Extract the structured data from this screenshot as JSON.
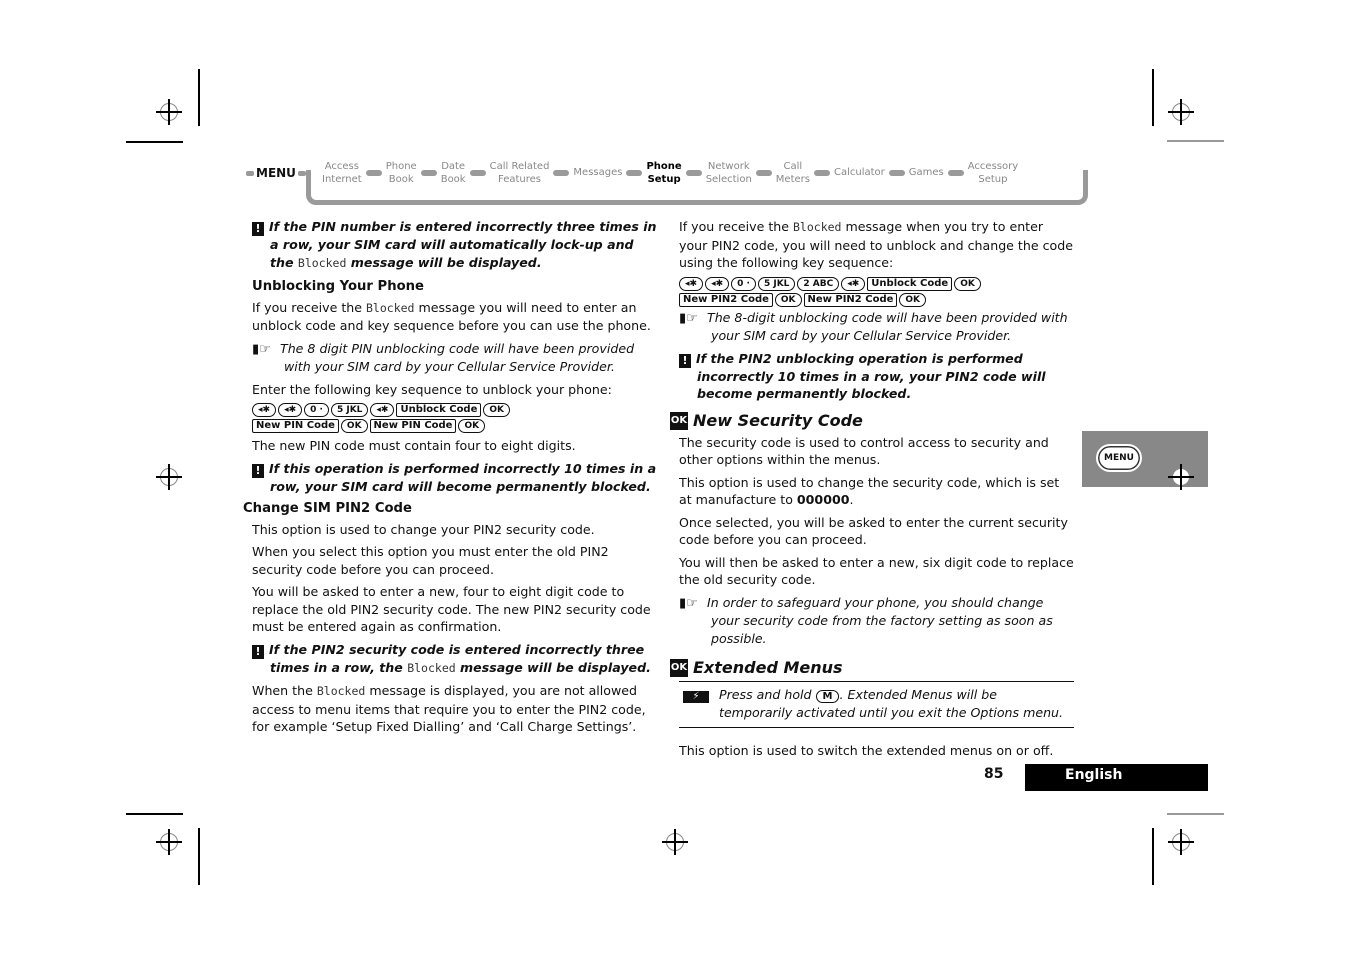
{
  "nav": {
    "menu_label": "MENU",
    "items": [
      {
        "line1": "Access",
        "line2": "Internet",
        "active": false
      },
      {
        "line1": "Phone",
        "line2": "Book",
        "active": false
      },
      {
        "line1": "Date",
        "line2": "Book",
        "active": false
      },
      {
        "line1": "Call Related",
        "line2": "Features",
        "active": false
      },
      {
        "line1": "Messages",
        "line2": "",
        "active": false
      },
      {
        "line1": "Phone",
        "line2": "Setup",
        "active": true
      },
      {
        "line1": "Network",
        "line2": "Selection",
        "active": false
      },
      {
        "line1": "Call",
        "line2": "Meters",
        "active": false
      },
      {
        "line1": "Calculator",
        "line2": "",
        "active": false
      },
      {
        "line1": "Games",
        "line2": "",
        "active": false
      },
      {
        "line1": "Accessory",
        "line2": "Setup",
        "active": false
      }
    ]
  },
  "left": {
    "warning1": {
      "pre": "If the PIN number is entered incorrectly three times in a row, your SIM card will automatically lock-up and the ",
      "lcd": "Blocked",
      "post": " message will be displayed."
    },
    "unblock_heading": "Unblocking Your Phone",
    "unblock_p1": {
      "pre": "If you receive the ",
      "lcd": "Blocked",
      "post": " message you will need to enter an unblock code and key sequence before you can use the phone."
    },
    "unblock_note": "The 8 digit PIN unblocking code will have been provided with your SIM card by your Cellular Service Provider.",
    "unblock_p2": "Enter the following key sequence to unblock your phone:",
    "keys_row1": [
      "◂✱",
      "◂✱",
      "0 ·",
      "5 JKL",
      "◂✱"
    ],
    "soft1": "Unblock Code",
    "ok": "OK",
    "soft2": "New PIN Code",
    "soft3": "New PIN Code",
    "pin_digits": "The new PIN code must contain four to eight digits.",
    "warning2": "If this operation is performed incorrectly 10 times in a row, your SIM card will become permanently blocked.",
    "pin2_heading": "Change SIM PIN2 Code",
    "pin2_p1": "This option is used to change your PIN2 security code.",
    "pin2_p2": "When you select this option you must enter the old PIN2 security code before you can proceed.",
    "pin2_p3": "You will be asked to enter a new, four to eight digit code to replace the old PIN2 security code. The new PIN2 security code must be entered again as confirmation.",
    "warning3": {
      "pre": "If the PIN2 security code is entered incorrectly three times in a row, the ",
      "lcd": "Blocked",
      "post": " message will be displayed."
    },
    "pin2_p4": {
      "pre": "When the ",
      "lcd": "Blocked",
      "post": " message is displayed, you are not allowed access to menu items that require you to enter the PIN2 code, for example ‘Setup Fixed Dialling’ and ‘Call Charge Settings’."
    }
  },
  "right": {
    "p1": {
      "pre": "If you receive the ",
      "lcd": "Blocked",
      "post": " message when you try to enter your PIN2 code, you will need to unblock and change the code using the following key sequence:"
    },
    "keys_row1": [
      "◂✱",
      "◂✱",
      "0 ·",
      "5 JKL",
      "2 ABC",
      "◂✱"
    ],
    "soft1": "Unblock Code",
    "ok": "OK",
    "soft2": "New PIN2 Code",
    "soft3": "New PIN2 Code",
    "note1": "The 8-digit unblocking code will have been provided with your SIM card by your Cellular Service Provider.",
    "warning1": "If the PIN2 unblocking operation is performed incorrectly 10 times in a row, your PIN2 code will become permanently blocked.",
    "security_heading": "New Security Code",
    "ok_icon": "OK",
    "sec_p1": "The security code is used to control access to security and other options within the menus.",
    "sec_p2_pre": "This option is used to change the security code, which is set at manufacture to ",
    "sec_p2_code": "000000",
    "sec_p2_post": ".",
    "sec_p3": "Once selected, you will be asked to enter the current security code before you can proceed.",
    "sec_p4": "You will then be asked to enter a new, six digit code to replace the old security code.",
    "sec_note": "In order to safeguard your phone, you should change your security code from the factory setting as soon as possible.",
    "ext_heading": "Extended Menus",
    "ext_shortcut_pre": "Press and hold ",
    "ext_key": "M",
    "ext_shortcut_post": ". Extended Menus will be temporarily activated until you exit the Options menu.",
    "ext_p1": "This option is used to switch the extended menus on or off."
  },
  "sidetab": {
    "menu_button": "MENU"
  },
  "footer": {
    "page_number": "85",
    "language": "English"
  }
}
